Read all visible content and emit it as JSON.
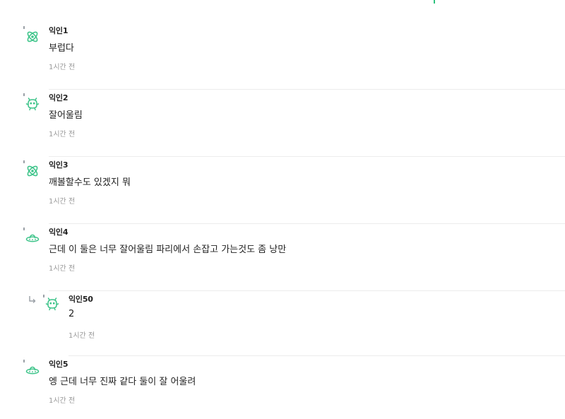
{
  "colors": {
    "accent": "#2ec27e",
    "avatar_green": "#3ec48a",
    "text": "#222222",
    "muted": "#999999",
    "divider": "#ececec"
  },
  "comments": [
    {
      "author": "익인1",
      "text": "부럽다",
      "time": "1시간 전",
      "avatar_icon": "atom-icon"
    },
    {
      "author": "익인2",
      "text": "잘어울림",
      "time": "1시간 전",
      "avatar_icon": "alien-icon"
    },
    {
      "author": "익인3",
      "text": "깨볼할수도 있겠지 뭐",
      "time": "1시간 전",
      "avatar_icon": "atom-icon"
    },
    {
      "author": "익인4",
      "text": "근데 이 둘은 너무 잘어울림 파리에서 손잡고 가는것도 좀 낭만",
      "time": "1시간 전",
      "avatar_icon": "ufo-icon"
    },
    {
      "author": "익인50",
      "text": "2",
      "time": "1시간 전",
      "avatar_icon": "alien-icon",
      "is_reply": true,
      "reply_icon": "reply-arrow-icon"
    },
    {
      "author": "익인5",
      "text": "엥 근데 너무 진짜 같다 둘이 잘 어울려",
      "time": "1시간 전",
      "avatar_icon": "ufo-icon"
    }
  ]
}
